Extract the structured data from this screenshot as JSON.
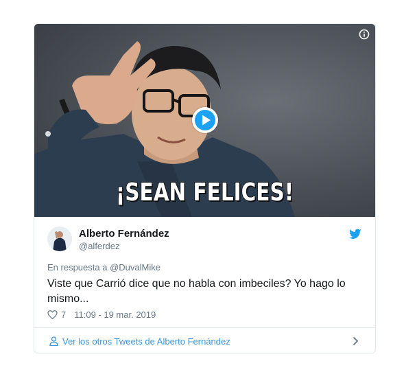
{
  "media": {
    "caption": "¡SEAN FELICES!",
    "info_icon": "info-icon",
    "play_icon": "play-icon"
  },
  "tweet": {
    "author_name": "Alberto Fernández",
    "author_handle": "@alferdez",
    "reply_prefix": "En respuesta a ",
    "reply_to": "@DuvalMike",
    "text": "Viste que Carrió dice que no habla con imbeciles? Yo hago lo mismo...",
    "likes": "7",
    "timestamp": "11:09 - 19 mar. 2019"
  },
  "footer": {
    "link_label": "Ver los otros Tweets de Alberto Fernández"
  },
  "colors": {
    "twitter_blue": "#1da1f2",
    "link_blue": "#3b94d9",
    "secondary_text": "#657786",
    "primary_text": "#14171a",
    "border": "#e1e8ed"
  }
}
